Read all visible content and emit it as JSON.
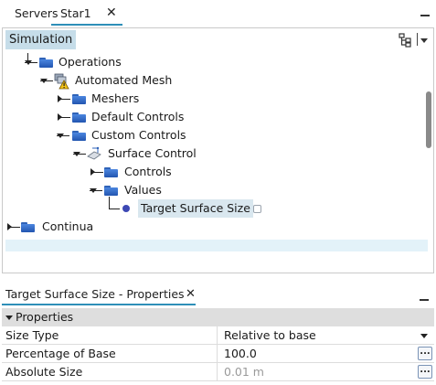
{
  "tabs": [
    {
      "label": "Servers"
    },
    {
      "label": "Star1",
      "active": true
    }
  ],
  "tree": {
    "header": "Simulation",
    "nodes": [
      {
        "label": "Operations",
        "icon": "folder-icon"
      },
      {
        "label": "Automated Mesh",
        "icon": "mesh-operation-warning-icon"
      },
      {
        "label": "Meshers",
        "icon": "folder-icon"
      },
      {
        "label": "Default Controls",
        "icon": "folder-icon"
      },
      {
        "label": "Custom Controls",
        "icon": "folder-icon"
      },
      {
        "label": "Surface Control",
        "icon": "surface-control-icon"
      },
      {
        "label": "Controls",
        "icon": "folder-icon"
      },
      {
        "label": "Values",
        "icon": "folder-icon"
      },
      {
        "label": "Target Surface Size",
        "icon": "value-dot-icon",
        "selected": true
      },
      {
        "label": "Continua",
        "icon": "folder-icon"
      }
    ]
  },
  "properties": {
    "title": "Target Surface Size - Properties",
    "section": "Properties",
    "rows": [
      {
        "name": "Size Type",
        "value": "Relative to base"
      },
      {
        "name": "Percentage of Base",
        "value": "100.0"
      },
      {
        "name": "Absolute Size",
        "value": "0.01 m"
      }
    ]
  },
  "colors": {
    "accent": "#2e8fb8",
    "selection": "#c6dde9",
    "folder": "#2f63b8"
  }
}
